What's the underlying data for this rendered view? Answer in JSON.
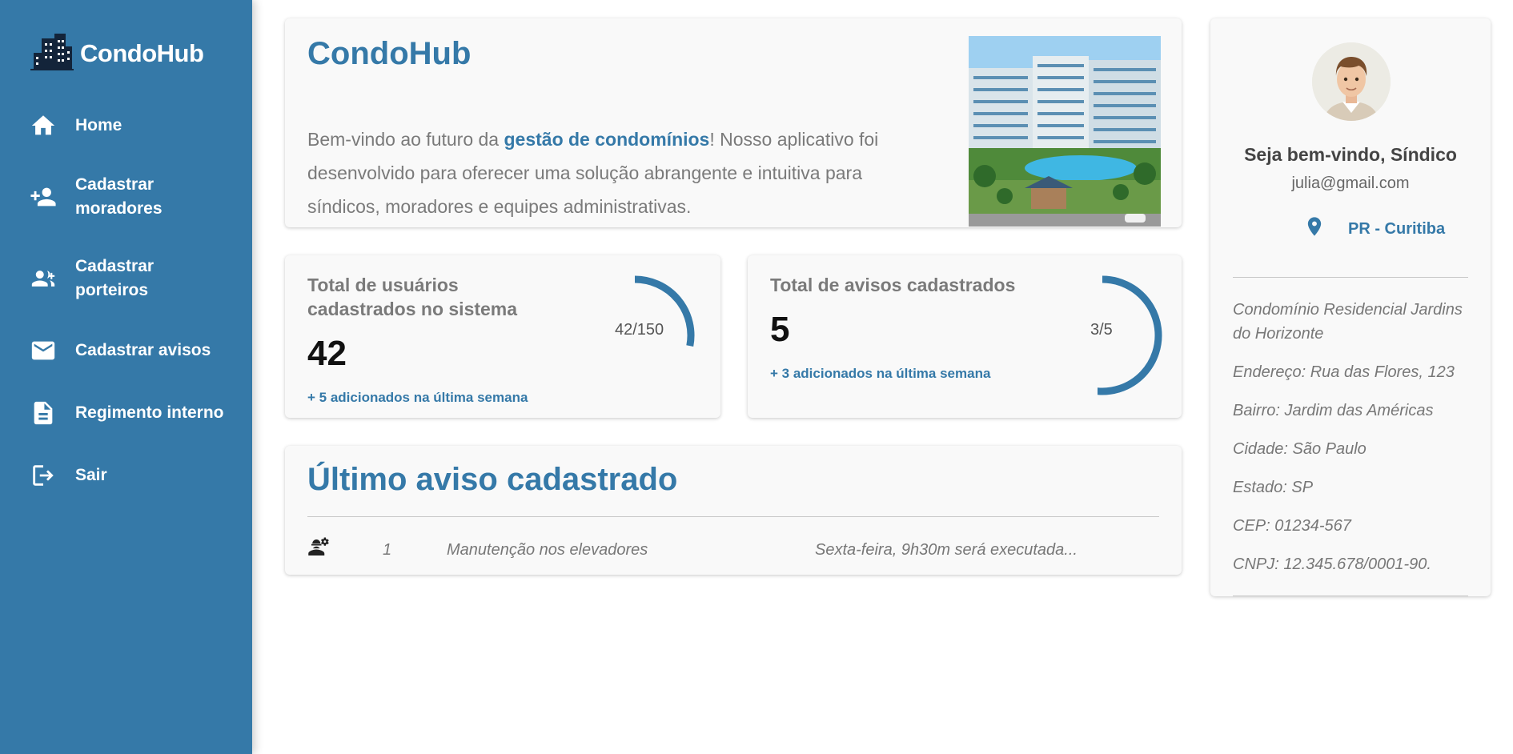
{
  "app": {
    "name": "CondoHub"
  },
  "sidebar": {
    "items": [
      {
        "label": "Home",
        "icon": "home-icon"
      },
      {
        "label": "Cadastrar moradores",
        "icon": "person-add-icon"
      },
      {
        "label": "Cadastrar porteiros",
        "icon": "group-add-icon"
      },
      {
        "label": "Cadastrar avisos",
        "icon": "mail-icon"
      },
      {
        "label": "Regimento interno",
        "icon": "document-icon"
      },
      {
        "label": "Sair",
        "icon": "logout-icon"
      }
    ]
  },
  "hero": {
    "title": "CondoHub",
    "text_before": "Bem-vindo ao futuro da ",
    "highlight": "gestão de condomínios",
    "text_after": "! Nosso aplicativo foi desenvolvido para oferecer uma solução abrangente e intuitiva para síndicos, moradores e equipes administrativas."
  },
  "stats": [
    {
      "title": "Total de usuários cadastrados no sistema",
      "value": "42",
      "sub": "+ 5 adicionados na última semana",
      "ratio": "42/150",
      "fraction": 0.28
    },
    {
      "title": "Total de avisos cadastrados",
      "value": "5",
      "sub": "+ 3 adicionados na última semana",
      "ratio": "3/5",
      "fraction": 0.6
    }
  ],
  "notice": {
    "title": "Último aviso cadastrado",
    "row": {
      "id": "1",
      "subject": "Manutenção nos elevadores",
      "description": "Sexta-feira, 9h30m será executada..."
    }
  },
  "profile": {
    "welcome": "Seja bem-vindo, Síndico",
    "email": "julia@gmail.com",
    "location": "PR - Curitiba",
    "info": [
      "Condomínio Residencial Jardins do Horizonte",
      "Endereço: Rua das Flores, 123",
      "Bairro: Jardim das Américas",
      "Cidade: São Paulo",
      "Estado: SP",
      "CEP: 01234-567",
      "CNPJ: 12.345.678/0001-90."
    ]
  },
  "colors": {
    "primary": "#3579a8",
    "card": "#f9f9f9",
    "muted_text": "#7a7a7a"
  }
}
